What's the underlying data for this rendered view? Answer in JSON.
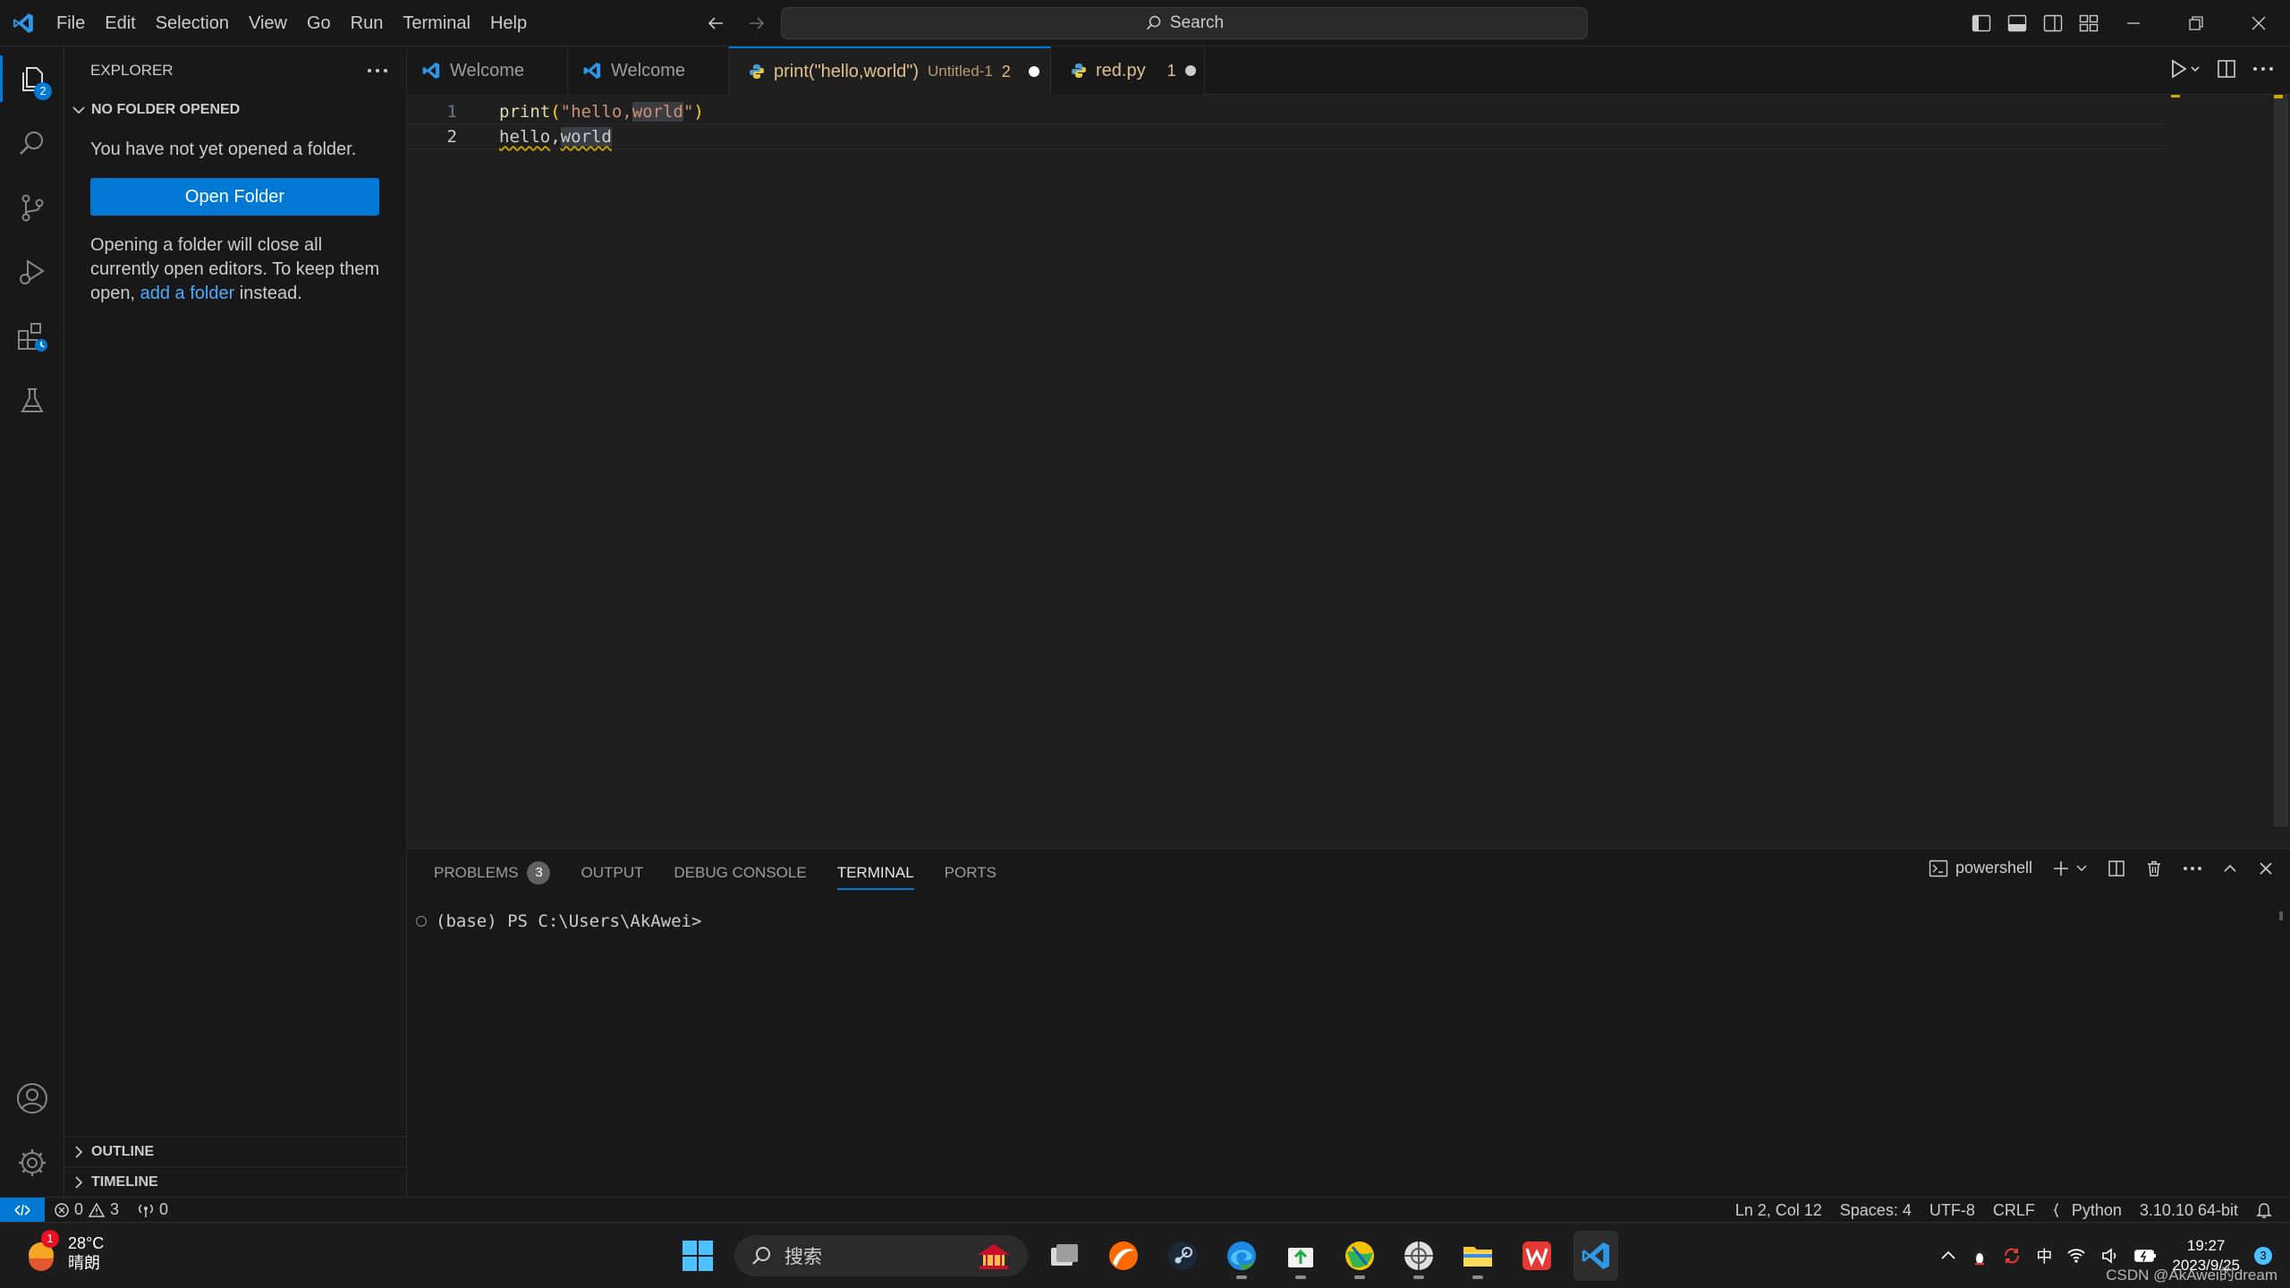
{
  "menubar": {
    "items": [
      "File",
      "Edit",
      "Selection",
      "View",
      "Go",
      "Run",
      "Terminal",
      "Help"
    ]
  },
  "command_center": {
    "placeholder": "Search"
  },
  "activity": {
    "explorer_badge": "2"
  },
  "sidebar": {
    "title": "EXPLORER",
    "section": "NO FOLDER OPENED",
    "message": "You have not yet opened a folder.",
    "open_folder_label": "Open Folder",
    "note_before": "Opening a folder will close all currently open editors. To keep them open, ",
    "note_link": "add a folder",
    "note_after": " instead.",
    "outline_label": "OUTLINE",
    "timeline_label": "TIMELINE"
  },
  "tabs": [
    {
      "label": "Welcome"
    },
    {
      "label": "Welcome"
    },
    {
      "label": "print(\"hello,world\")",
      "description": "Untitled-1",
      "count": "2"
    },
    {
      "label": "red.py",
      "count": "1"
    }
  ],
  "editor": {
    "lines": [
      {
        "number": "1",
        "tokens": {
          "fn": "print",
          "open": "(",
          "str_a": "\"hello,",
          "str_b": "world",
          "str_c": "\"",
          "close": ")"
        }
      },
      {
        "number": "2",
        "tokens": {
          "a": "hello",
          "b": ",",
          "c": "world"
        }
      }
    ]
  },
  "panel": {
    "tabs": [
      "PROBLEMS",
      "OUTPUT",
      "DEBUG CONSOLE",
      "TERMINAL",
      "PORTS"
    ],
    "problems_count": "3",
    "active_tab": "TERMINAL",
    "shell": "powershell",
    "terminal_prompt": "(base) PS C:\\Users\\AkAwei>"
  },
  "statusbar": {
    "errors": "0",
    "warnings": "3",
    "ports": "0",
    "cursor": "Ln 2, Col 12",
    "spaces": "Spaces: 4",
    "encoding": "UTF-8",
    "eol": "CRLF",
    "language": "Python",
    "interpreter": "3.10.10 64-bit"
  },
  "taskbar": {
    "weather_temp": "28°C",
    "weather_desc": "晴朗",
    "weather_badge": "1",
    "search_label": "搜索",
    "ime": "中",
    "time": "19:27",
    "date": "2023/9/25",
    "notif_count": "3",
    "watermark": "CSDN @AkAwei的dream"
  },
  "colors": {
    "accent": "#0078d4",
    "modified_tab": "#e2c08d",
    "string": "#ce9178",
    "function": "#dcdcaa"
  }
}
